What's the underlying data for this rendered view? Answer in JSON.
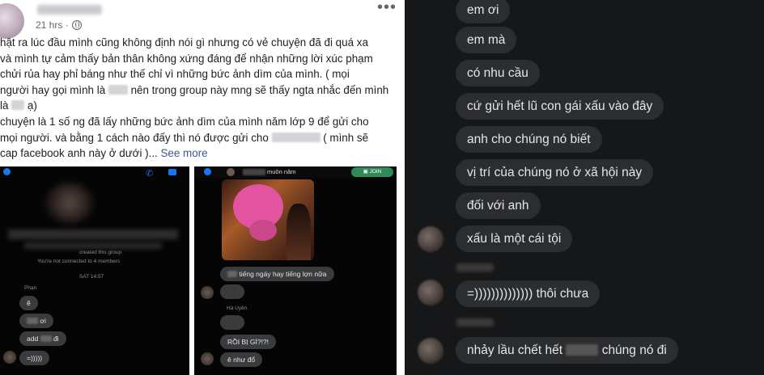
{
  "post": {
    "timestamp": "21 hrs ·",
    "lines": [
      "hật ra lúc đầu mình cũng không định nói gì nhưng có vẻ chuyện đã đi quá xa",
      "và mình tự cảm thấy bản thân không xứng đáng để nhận những lời xúc phạm",
      "chửi rủa hay phỉ báng như thế chỉ vì những bức ảnh dìm của mình. ( mọi"
    ],
    "line4_a": "người hay gọi mình là ",
    "line4_b": " nên trong group này mng sẽ thấy ngta nhắc đến mình",
    "line5_a": "là ",
    "line5_b": " ạ)",
    "line6": "chuyện là 1 số ng đã lấy những bức ảnh dìm của mình năm lớp 9 để gửi cho",
    "line7_a": "mọi người. và bằng 1 cách nào đấy thì nó được gửi cho ",
    "line7_b": " ( mình sẽ",
    "line8": "cap facebook anh này ở dưới )...",
    "see_more": "See more",
    "menu_icon": "more-horizontal-icon",
    "privacy_icon": "globe-icon"
  },
  "screenshot1": {
    "system_1": "created this group",
    "system_2": "You're not connected to 4 members",
    "date": "SAT 14:57",
    "sender": "Phan",
    "messages": [
      "ê",
      "ơi",
      "add",
      "đi",
      "=)))))"
    ]
  },
  "screenshot2": {
    "header_name": "muôn năm",
    "join_label": "JOIN",
    "sender": "Hà Uyên",
    "messages": [
      "tiếng ngáy hay tiếng lợn nữa",
      "RỒI BỊ GÌ?!?!",
      "ê như đổ"
    ]
  },
  "chat": {
    "messages": [
      "em ơi",
      "em mà",
      "có nhu cầu",
      "cứ gửi hết lũ con gái xấu vào đây",
      "anh cho chúng nó biết",
      "vị trí của chúng nó ở xã hội này",
      "đối với anh",
      "xấu là một cái tội",
      "=))))))))))))))  thôi chưa",
      "nhảy lầu chết hết",
      "chúng nó đi"
    ]
  }
}
